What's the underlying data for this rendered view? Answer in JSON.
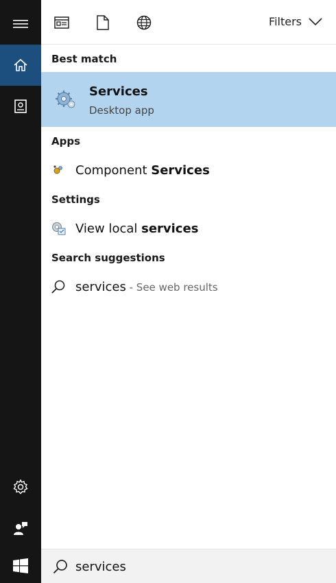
{
  "rail": {
    "items": [
      "hamburger-menu",
      "home",
      "notebook",
      "settings",
      "feedback",
      "start"
    ]
  },
  "toolbar": {
    "filters_label": "Filters"
  },
  "sections": {
    "best_match": "Best match",
    "apps": "Apps",
    "settings": "Settings",
    "search_suggestions": "Search suggestions"
  },
  "best_match": {
    "title": "Services",
    "subtitle": "Desktop app"
  },
  "apps": [
    {
      "prefix": "Component ",
      "bold": "Services"
    }
  ],
  "settings": [
    {
      "prefix": "View local ",
      "bold": "services"
    }
  ],
  "suggestions": [
    {
      "term": "services",
      "suffix": " - See web results"
    }
  ],
  "search": {
    "value": "services"
  },
  "colors": {
    "rail_bg": "#151515",
    "rail_active": "#1d4f7e",
    "best_match_highlight": "#b3d4ee",
    "searchbar_bg": "#f2f2f2"
  }
}
